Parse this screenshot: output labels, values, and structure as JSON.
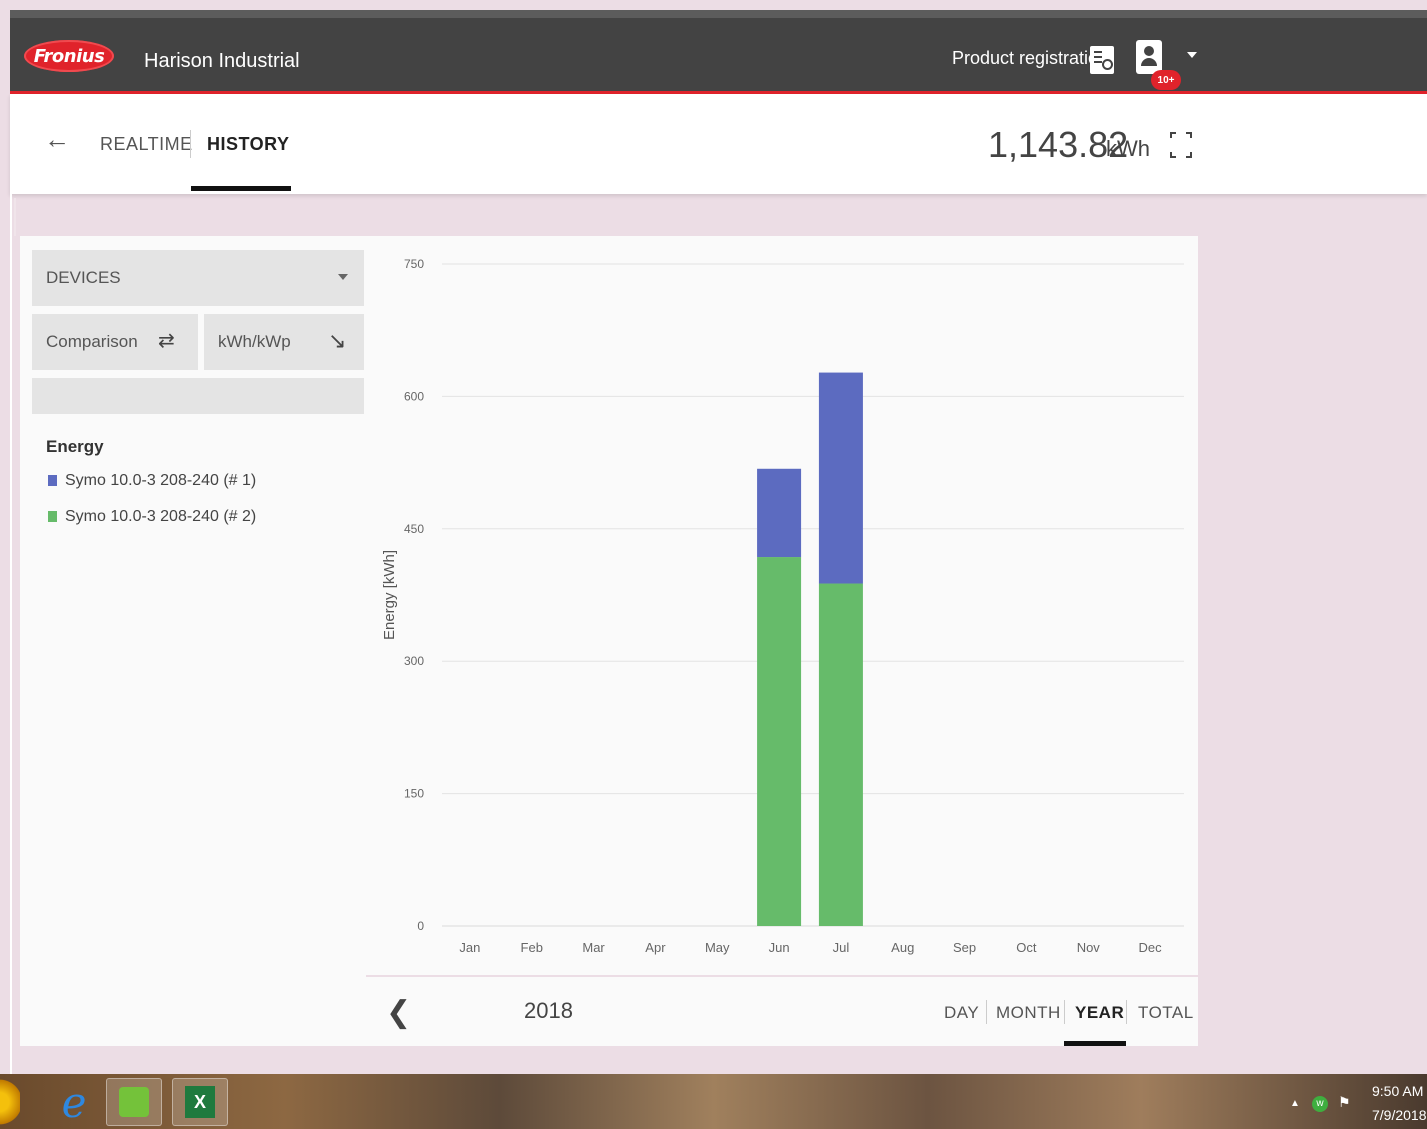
{
  "header": {
    "logo_text": "Fronius",
    "site_name": "Harison Industrial",
    "product_registration": "Product registration",
    "notification_badge": "10+"
  },
  "subheader": {
    "tabs": [
      {
        "label": "REALTIME",
        "active": false
      },
      {
        "label": "HISTORY",
        "active": true
      }
    ],
    "total_value": "1,143.82",
    "total_unit": "kWh"
  },
  "sidebar": {
    "devices_label": "DEVICES",
    "comparison_label": "Comparison",
    "kwh_label": "kWh/kWp",
    "legend_title": "Energy",
    "legend_items": [
      {
        "label": "Symo 10.0-3 208-240 (# 1)",
        "color": "#5c6bc0"
      },
      {
        "label": "Symo 10.0-3 208-240 (# 2)",
        "color": "#66bb6a"
      }
    ]
  },
  "chart_data": {
    "type": "bar",
    "stacked": true,
    "categories": [
      "Jan",
      "Feb",
      "Mar",
      "Apr",
      "May",
      "Jun",
      "Jul",
      "Aug",
      "Sep",
      "Oct",
      "Nov",
      "Dec"
    ],
    "series": [
      {
        "name": "Symo 10.0-3 208-240 (# 2)",
        "color": "#66bb6a",
        "values": [
          0,
          0,
          0,
          0,
          0,
          418,
          388,
          0,
          0,
          0,
          0,
          0
        ]
      },
      {
        "name": "Symo 10.0-3 208-240 (# 1)",
        "color": "#5c6bc0",
        "values": [
          0,
          0,
          0,
          0,
          0,
          100,
          239,
          0,
          0,
          0,
          0,
          0
        ]
      }
    ],
    "ylabel": "Energy [kWh]",
    "yticks": [
      0,
      150,
      300,
      450,
      600,
      750
    ],
    "ylim": [
      0,
      750
    ],
    "grid": true
  },
  "footer": {
    "year": "2018",
    "ranges": [
      {
        "label": "DAY",
        "active": false
      },
      {
        "label": "MONTH",
        "active": false
      },
      {
        "label": "YEAR",
        "active": true
      },
      {
        "label": "TOTAL",
        "active": false
      }
    ]
  },
  "taskbar": {
    "time": "9:50 AM",
    "date": "7/9/2018"
  }
}
